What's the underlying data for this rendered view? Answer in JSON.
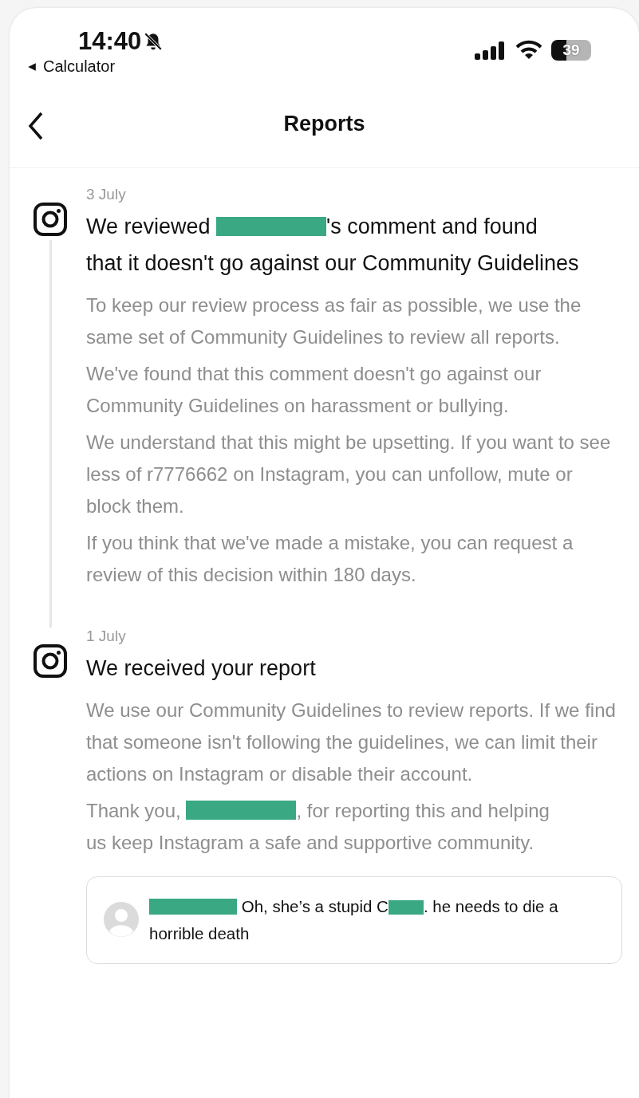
{
  "status_bar": {
    "time": "14:40",
    "muted": true,
    "back_app": "Calculator",
    "battery": "39"
  },
  "header": {
    "title": "Reports"
  },
  "reports": [
    {
      "date": "3 July",
      "title": [
        {
          "kind": "text",
          "text": "We reviewed "
        },
        {
          "kind": "redaction"
        },
        {
          "kind": "text",
          "text": "'s comment and found"
        },
        {
          "kind": "line",
          "text": "that it doesn't go against our Community Guidelines"
        }
      ],
      "paragraphs": [
        [
          {
            "kind": "line",
            "text": "To keep our review process as fair as possible, we use the same set of Community Guidelines to review all reports."
          }
        ],
        [
          {
            "kind": "line",
            "text": "We've found that this comment doesn't go against our Community Guidelines on harassment or bullying."
          }
        ],
        [
          {
            "kind": "line",
            "text": "We understand that this might be upsetting. If you want to see less of r7776662 on Instagram, you can unfollow, mute or block them."
          }
        ],
        [
          {
            "kind": "line",
            "text": "If you think that we've made a mistake, you can request a review of this decision within 180 days."
          }
        ]
      ]
    },
    {
      "date": "1 July",
      "title": [
        {
          "kind": "line",
          "text": "We received your report"
        }
      ],
      "paragraphs": [
        [
          {
            "kind": "line",
            "text": "We use our Community Guidelines to review reports. If we find that someone isn't following the guidelines, we can limit their actions on Instagram or disable their account."
          }
        ],
        [
          {
            "kind": "text",
            "text": "Thank you, "
          },
          {
            "kind": "redaction"
          },
          {
            "kind": "text",
            "text": ", for reporting this and helping"
          },
          {
            "kind": "line",
            "text": "us keep Instagram a safe and supportive community."
          }
        ]
      ],
      "comment": [
        {
          "kind": "redaction"
        },
        {
          "kind": "text",
          "text": " Oh, she’s a stupid C"
        },
        {
          "kind": "short-redaction"
        },
        {
          "kind": "text",
          "text": ". he needs to die a"
        },
        {
          "kind": "line",
          "text": "horrible death"
        }
      ]
    }
  ]
}
